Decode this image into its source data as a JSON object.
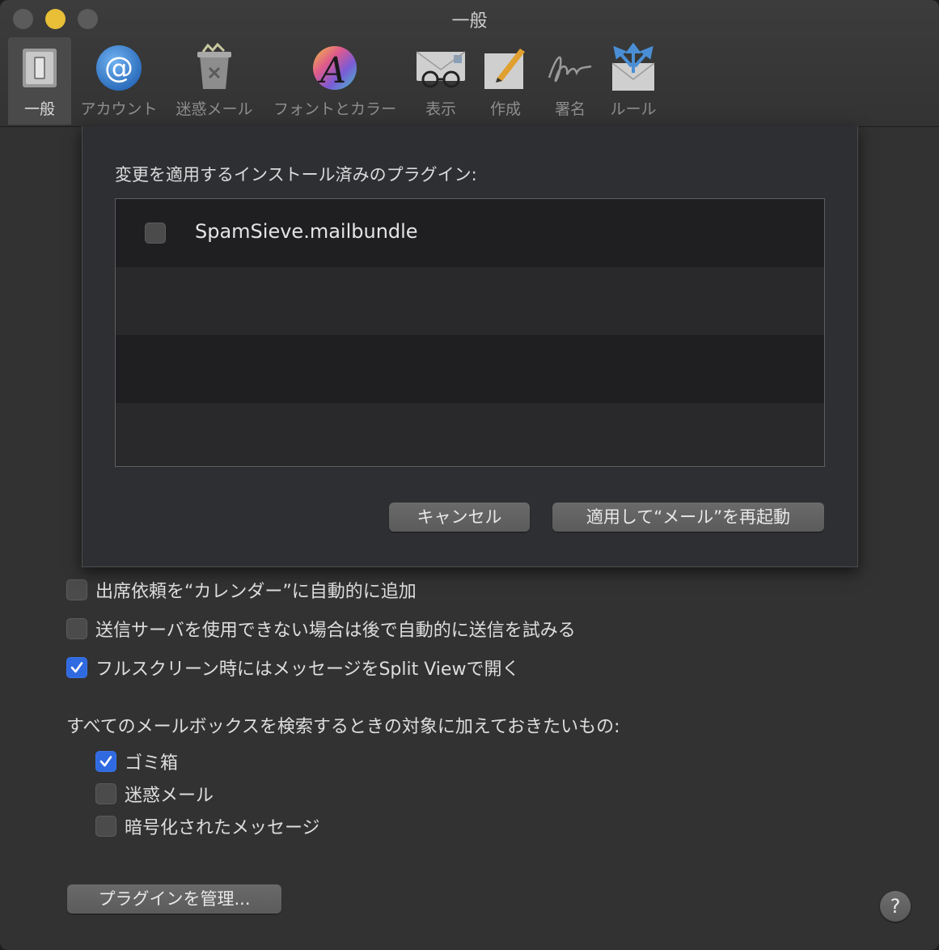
{
  "window": {
    "title": "一般"
  },
  "toolbar": {
    "items": [
      {
        "label": "一般",
        "icon": "general-switch-icon",
        "selected": true
      },
      {
        "label": "アカウント",
        "icon": "at-sign-icon"
      },
      {
        "label": "迷惑メール",
        "icon": "junk-trash-icon"
      },
      {
        "label": "フォントとカラー",
        "icon": "font-color-icon"
      },
      {
        "label": "表示",
        "icon": "viewing-glasses-icon"
      },
      {
        "label": "作成",
        "icon": "compose-pencil-icon"
      },
      {
        "label": "署名",
        "icon": "signature-icon"
      },
      {
        "label": "ルール",
        "icon": "rules-envelope-icon"
      }
    ]
  },
  "sheet": {
    "label": "変更を適用するインストール済みのプラグイン:",
    "plugins": [
      {
        "name": "SpamSieve.mailbundle",
        "checked": false
      }
    ],
    "cancel_label": "キャンセル",
    "apply_label": "適用して“メール”を再起動"
  },
  "options": [
    {
      "label": "出席依頼を“カレンダー”に自動的に追加",
      "checked": false
    },
    {
      "label": "送信サーバを使用できない場合は後で自動的に送信を試みる",
      "checked": false
    },
    {
      "label": "フルスクリーン時にはメッセージをSplit Viewで開く",
      "checked": true
    }
  ],
  "search": {
    "label": "すべてのメールボックスを検索するときの対象に加えておきたいもの:",
    "items": [
      {
        "label": "ゴミ箱",
        "checked": true
      },
      {
        "label": "迷惑メール",
        "checked": false
      },
      {
        "label": "暗号化されたメッセージ",
        "checked": false
      }
    ]
  },
  "manage_plugins_label": "プラグインを管理...",
  "help_label": "?",
  "colors": {
    "accent": "#2f6ae1",
    "minimize": "#e9bf37"
  }
}
